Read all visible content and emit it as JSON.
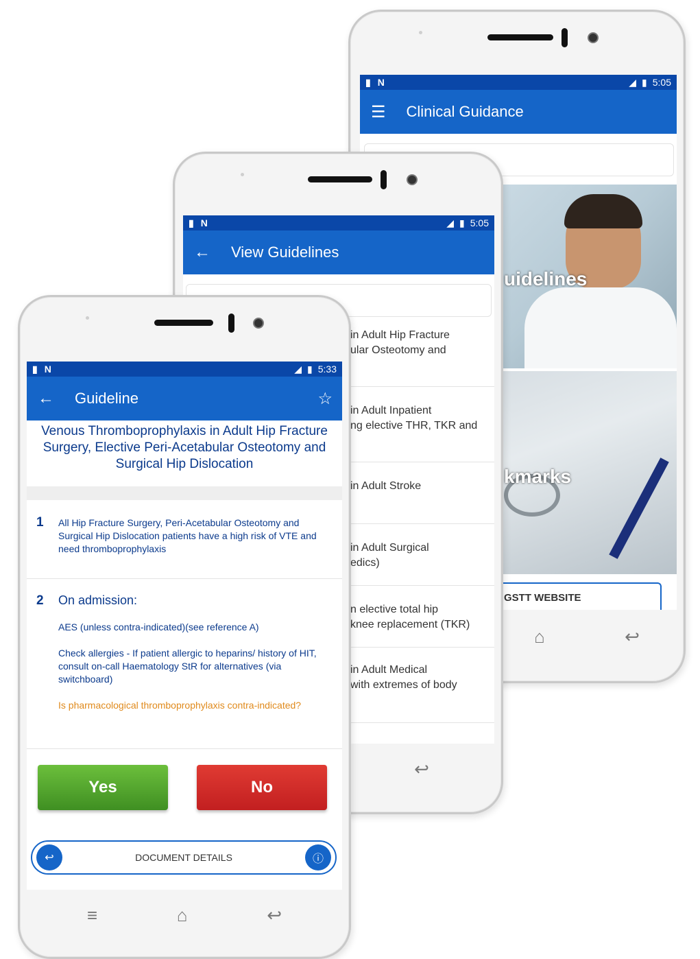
{
  "phone3": {
    "status_time": "5:05",
    "title": "Clinical Guidance",
    "tile1_label": "uidelines",
    "tile2_label": "kmarks",
    "website_button": "GSTT WEBSITE"
  },
  "phone2": {
    "status_time": "5:05",
    "title": "View Guidelines",
    "items": [
      {
        "line1": "in Adult Hip Fracture",
        "line2": "ular Osteotomy and"
      },
      {
        "line1": "in Adult Inpatient",
        "line2": "ng elective THR, TKR and"
      },
      {
        "line1": "in Adult Stroke",
        "line2": ""
      },
      {
        "line1": "in Adult Surgical",
        "line2": "edics)"
      },
      {
        "line1": "n elective total hip",
        "line2": "knee replacement (TKR)"
      },
      {
        "line1": "in Adult Medical",
        "line2": "with extremes of body"
      }
    ]
  },
  "phone1": {
    "status_time": "5:33",
    "title": "Guideline",
    "heading": "Venous Thromboprophylaxis in Adult Hip Fracture Surgery, Elective Peri-Acetabular Osteotomy and Surgical Hip Dislocation",
    "step1_number": "1",
    "step1_text": "All Hip Fracture Surgery, Peri-Acetabular Osteotomy and Surgical Hip Dislocation patients have a high risk of VTE and need thromboprophylaxis",
    "step2_number": "2",
    "step2_title": "On admission:",
    "step2_line1": "AES (unless contra-indicated)(see reference A)",
    "step2_line2": "Check allergies - If patient allergic to heparins/ history of HIT, consult on-call Haematology StR for alternatives (via switchboard)",
    "step2_question": "Is pharmacological thromboprophylaxis contra-indicated?",
    "yes_label": "Yes",
    "no_label": "No",
    "doc_details": "DOCUMENT DETAILS"
  },
  "colors": {
    "appbar": "#1565c8",
    "status": "#0a47a8",
    "heading_text": "#0b3a8c",
    "question_text": "#e08a1c",
    "yes_green": "#5aa832",
    "no_red": "#d9282a"
  }
}
